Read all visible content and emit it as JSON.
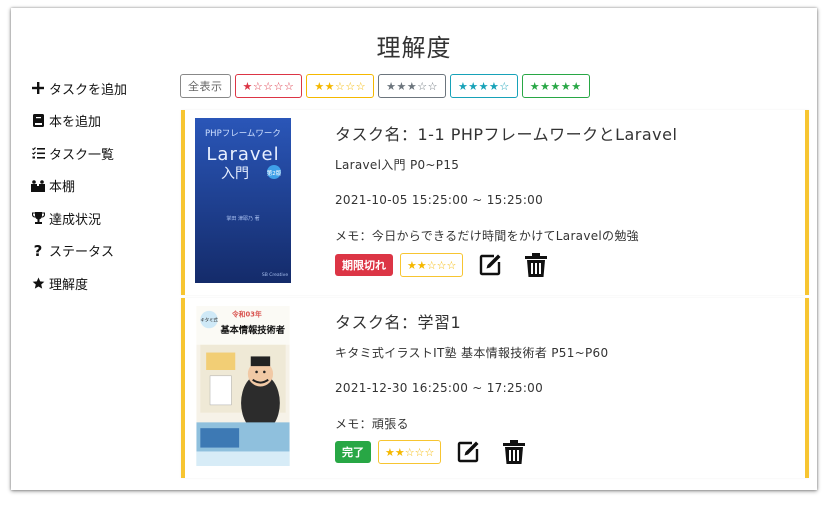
{
  "page": {
    "title": "理解度"
  },
  "sidebar": {
    "items": [
      {
        "icon": "plus-icon",
        "label": "タスクを追加"
      },
      {
        "icon": "book-icon",
        "label": "本を追加"
      },
      {
        "icon": "list-icon",
        "label": "タスク一覧"
      },
      {
        "icon": "bookshelf-icon",
        "label": "本棚"
      },
      {
        "icon": "trophy-icon",
        "label": "達成状況"
      },
      {
        "icon": "question-icon",
        "label": "ステータス"
      },
      {
        "icon": "star-icon",
        "label": "理解度"
      }
    ]
  },
  "filters": [
    {
      "label": "全表示",
      "color": "#888888"
    },
    {
      "label": "★☆☆☆☆",
      "color": "#dc3545"
    },
    {
      "label": "★★☆☆☆",
      "color": "#f5b800"
    },
    {
      "label": "★★★☆☆",
      "color": "#6c757d"
    },
    {
      "label": "★★★★☆",
      "color": "#17a2b8"
    },
    {
      "label": "★★★★★",
      "color": "#28a745"
    }
  ],
  "tasks": [
    {
      "title": "タスク名：1-1 PHPフレームワークとLaravel",
      "book": "Laravel入門  P0~P15",
      "datetime": "2021-10-05 15:25:00 ~ 15:25:00",
      "memo": "メモ：今日からできるだけ時間をかけてLaravelの勉強",
      "status": "期限切れ",
      "status_color": "#dc3545",
      "rating": "★★☆☆☆",
      "cover": {
        "line1": "PHPフレームワーク",
        "line2": "Laravel",
        "line3": "入門",
        "edition": "第2版",
        "author": "掌田 津耶乃 著",
        "publisher": "SB Creative"
      }
    },
    {
      "title": "タスク名：学習1",
      "book": "キタミ式イラストIT塾 基本情報技術者  P51~P60",
      "datetime": "2021-12-30 16:25:00 ~ 17:25:00",
      "memo": "メモ：頑張る",
      "status": "完了",
      "status_color": "#28a745",
      "rating": "★★☆☆☆",
      "cover": {
        "line1": "令和03年",
        "line2": "キタミ式",
        "line3": "基本情報技術者"
      }
    }
  ]
}
